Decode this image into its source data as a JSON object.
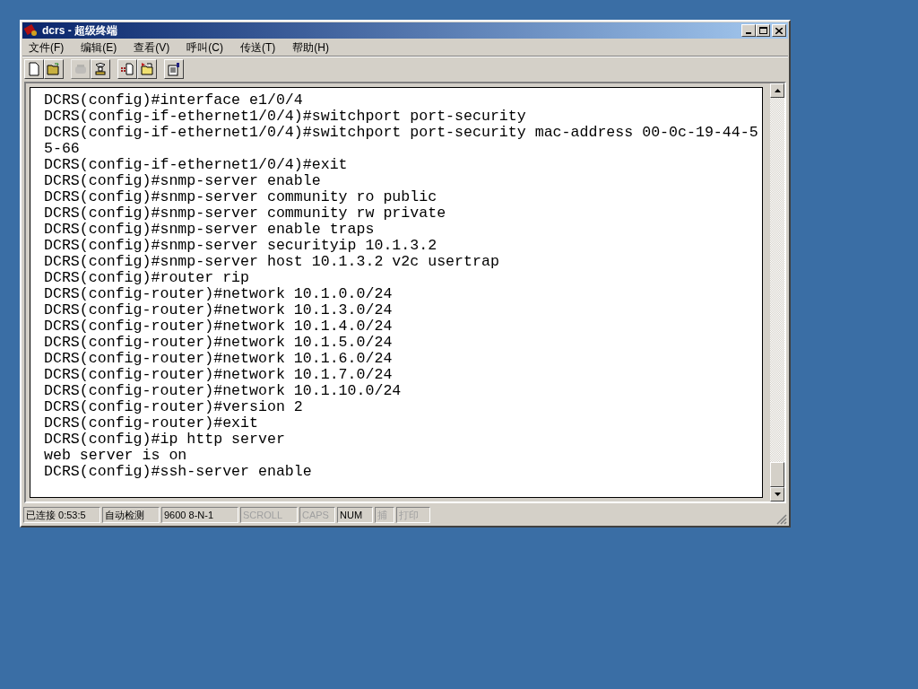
{
  "window": {
    "title": "dcrs - 超级终端"
  },
  "menu": [
    {
      "label": "文件(F)"
    },
    {
      "label": "编辑(E)"
    },
    {
      "label": "查看(V)"
    },
    {
      "label": "呼叫(C)"
    },
    {
      "label": "传送(T)"
    },
    {
      "label": "帮助(H)"
    }
  ],
  "toolbar": [
    {
      "kind": "new",
      "disabled": false
    },
    {
      "kind": "open",
      "disabled": false
    },
    {
      "kind": "phone",
      "disabled": true
    },
    {
      "kind": "hangup",
      "disabled": false
    },
    {
      "kind": "send",
      "disabled": false
    },
    {
      "kind": "receive",
      "disabled": false
    },
    {
      "kind": "properties",
      "disabled": false
    }
  ],
  "terminal": {
    "lines": [
      "DCRS(config)#interface e1/0/4",
      "DCRS(config-if-ethernet1/0/4)#switchport port-security",
      "DCRS(config-if-ethernet1/0/4)#switchport port-security mac-address 00-0c-19-44-5",
      "5-66",
      "DCRS(config-if-ethernet1/0/4)#exit",
      "DCRS(config)#snmp-server enable",
      "DCRS(config)#snmp-server community ro public",
      "DCRS(config)#snmp-server community rw private",
      "DCRS(config)#snmp-server enable traps",
      "DCRS(config)#snmp-server securityip 10.1.3.2",
      "DCRS(config)#snmp-server host 10.1.3.2 v2c usertrap",
      "DCRS(config)#router rip",
      "DCRS(config-router)#network 10.1.0.0/24",
      "DCRS(config-router)#network 10.1.3.0/24",
      "DCRS(config-router)#network 10.1.4.0/24",
      "DCRS(config-router)#network 10.1.5.0/24",
      "DCRS(config-router)#network 10.1.6.0/24",
      "DCRS(config-router)#network 10.1.7.0/24",
      "DCRS(config-router)#network 10.1.10.0/24",
      "DCRS(config-router)#version 2",
      "DCRS(config-router)#exit",
      "DCRS(config)#ip http server",
      "web server is on",
      "DCRS(config)#ssh-server enable"
    ]
  },
  "status_bar": [
    {
      "text": "已连接 0:53:5",
      "disabled": false
    },
    {
      "text": "自动检测",
      "disabled": false
    },
    {
      "text": "9600 8-N-1",
      "disabled": false
    },
    {
      "text": "SCROLL",
      "disabled": true
    },
    {
      "text": "CAPS",
      "disabled": true
    },
    {
      "text": "NUM",
      "disabled": false
    },
    {
      "text": "捕",
      "disabled": true
    },
    {
      "text": "打印",
      "disabled": true
    }
  ]
}
